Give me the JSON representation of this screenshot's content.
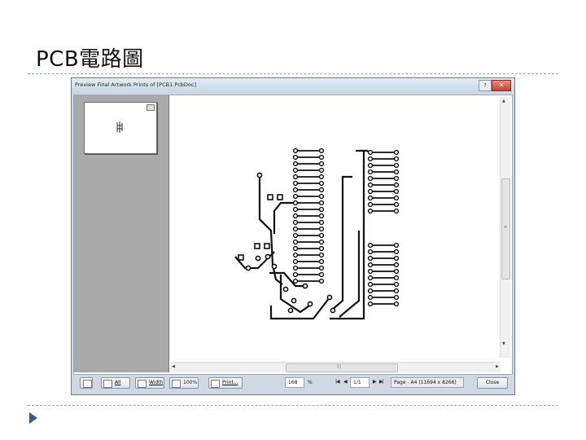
{
  "slide": {
    "title": "PCB電路圖"
  },
  "window": {
    "title": "Preview Final Artwork Prints of [PCB1.PcbDoc]",
    "help_label": "?",
    "close_label": "✕"
  },
  "toolbar": {
    "all_label": "All",
    "width_label": "Width",
    "zoom100_label": "100%",
    "print_label": "Print...",
    "zoom_value": "168",
    "zoom_unit": "%",
    "page_value": "1/1",
    "page_info": "Page - A4 (11694 x 8266)",
    "close_label": "Close"
  },
  "scroll": {
    "grip": "≡",
    "h_grip": "|||"
  },
  "colors": {
    "accent": "#3b5a8a",
    "close_button": "#c7402c"
  }
}
